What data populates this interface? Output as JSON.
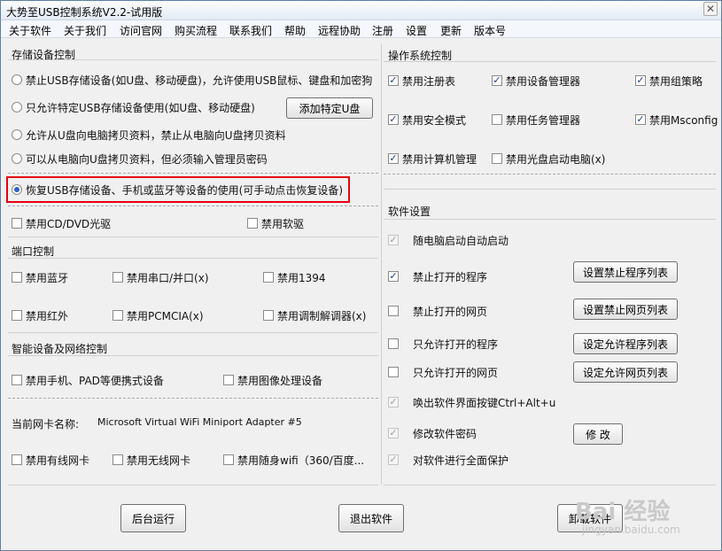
{
  "window": {
    "title": "大势至USB控制系统V2.2-试用版",
    "close": "✕"
  },
  "menu": [
    "关于软件",
    "关于我们",
    "访问官网",
    "购买流程",
    "联系我们",
    "帮助",
    "远程协助",
    "注册",
    "设置",
    "更新",
    "版本号"
  ],
  "storage": {
    "title": "存储设备控制",
    "options": [
      "禁止USB存储设备(如U盘、移动硬盘)，允许使用USB鼠标、键盘和加密狗",
      "只允许特定USB存储设备使用(如U盘、移动硬盘)",
      "允许从U盘向电脑拷贝资料，禁止从电脑向U盘拷贝资料",
      "可以从电脑向U盘拷贝资料，但必须输入管理员密码",
      "恢复USB存储设备、手机或蓝牙等设备的使用(可手动点击恢复设备)"
    ],
    "add_button": "添加特定U盘",
    "cd": "禁用CD/DVD光驱",
    "floppy": "禁用软驱"
  },
  "ports": {
    "title": "端口控制",
    "items": [
      "禁用蓝牙",
      "禁用串口/并口(x)",
      "禁用1394",
      "禁用红外",
      "禁用PCMCIA(x)",
      "禁用调制解调器(x)"
    ]
  },
  "network": {
    "title": "智能设备及网络控制",
    "mobile": "禁用手机、PAD等便携式设备",
    "imaging": "禁用图像处理设备",
    "nic_label": "当前网卡名称:",
    "nic_value": "Microsoft Virtual WiFi Miniport Adapter #5",
    "wired": "禁用有线网卡",
    "wireless": "禁用无线网卡",
    "portable_wifi": "禁用随身wifi（360/百度..."
  },
  "os": {
    "title": "操作系统控制",
    "items": [
      "禁用注册表",
      "禁用设备管理器",
      "禁用组策略",
      "禁用安全模式",
      "禁用任务管理器",
      "禁用Msconfig",
      "禁用计算机管理",
      "禁用光盘启动电脑(x)"
    ]
  },
  "software": {
    "title": "软件设置",
    "autostart": "随电脑启动自动启动",
    "block_programs": "禁止打开的程序",
    "block_programs_btn": "设置禁止程序列表",
    "block_web": "禁止打开的网页",
    "block_web_btn": "设置禁止网页列表",
    "allow_programs": "只允许打开的程序",
    "allow_programs_btn": "设定允许程序列表",
    "allow_web": "只允许打开的网页",
    "allow_web_btn": "设定允许网页列表",
    "hotkey": "唤出软件界面按键Ctrl+Alt+u",
    "change_pwd": "修改软件密码",
    "change_pwd_btn": "修 改",
    "protect": "对软件进行全面保护"
  },
  "footer": {
    "background": "后台运行",
    "exit": "退出软件",
    "uninstall": "卸载软件"
  },
  "watermark": {
    "logo": "Bai 经验",
    "url": "jingyan.baidu.com"
  },
  "colors": {
    "highlight": "#e60012",
    "check": "#1a3f8a"
  }
}
